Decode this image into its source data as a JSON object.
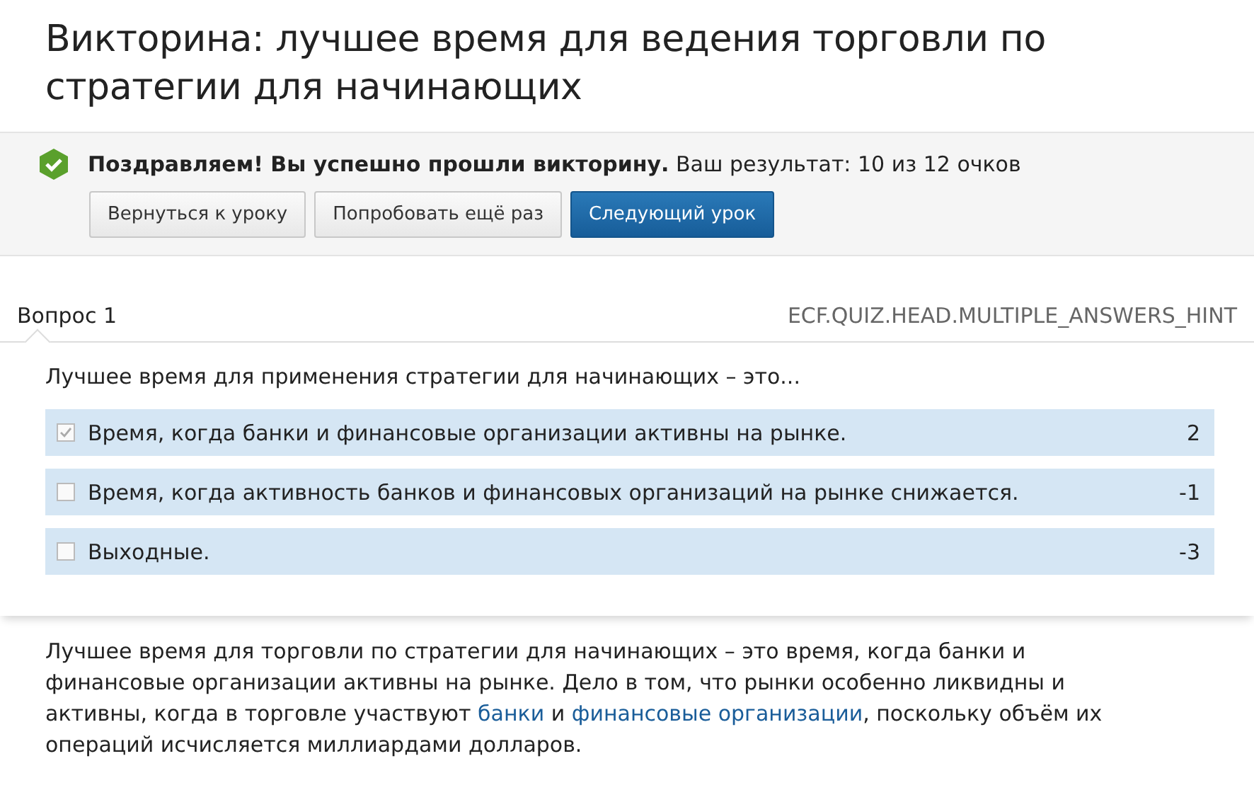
{
  "title": "Викторина: лучшее время для ведения торговли по стратегии для начинающих",
  "result": {
    "headline": "Поздравляем! Вы успешно прошли викторину.",
    "score": "Ваш результат: 10 из 12 очков"
  },
  "buttons": [
    {
      "label": "Вернуться к уроку",
      "kind": "secondary"
    },
    {
      "label": "Попробовать ещё раз",
      "kind": "secondary"
    },
    {
      "label": "Следующий урок",
      "kind": "primary"
    }
  ],
  "question": {
    "number": "Вопрос 1",
    "hint": "ECF.QUIZ.HEAD.MULTIPLE_ANSWERS_HINT",
    "text": "Лучшее время для применения стратегии для начинающих – это...",
    "answers": [
      {
        "text": "Время, когда банки и финансовые организации активны на рынке.",
        "points": "2",
        "checked": true
      },
      {
        "text": "Время, когда активность банков и финансовых организаций на рынке снижается.",
        "points": "-1",
        "checked": false
      },
      {
        "text": "Выходные.",
        "points": "-3",
        "checked": false
      }
    ]
  },
  "explanation": [
    {
      "kind": "text",
      "text": "Лучшее время для торговли по стратегии для начинающих – это время, когда банки и финансовые организации активны на рынке. Дело в том, что рынки особенно ликвидны и активны, когда в торговле участвуют "
    },
    {
      "kind": "link",
      "text": "банки"
    },
    {
      "kind": "text",
      "text": " и "
    },
    {
      "kind": "link",
      "text": "финансовые организации"
    },
    {
      "kind": "text",
      "text": ", поскольку объём их операций исчисляется миллиардами долларов."
    }
  ]
}
